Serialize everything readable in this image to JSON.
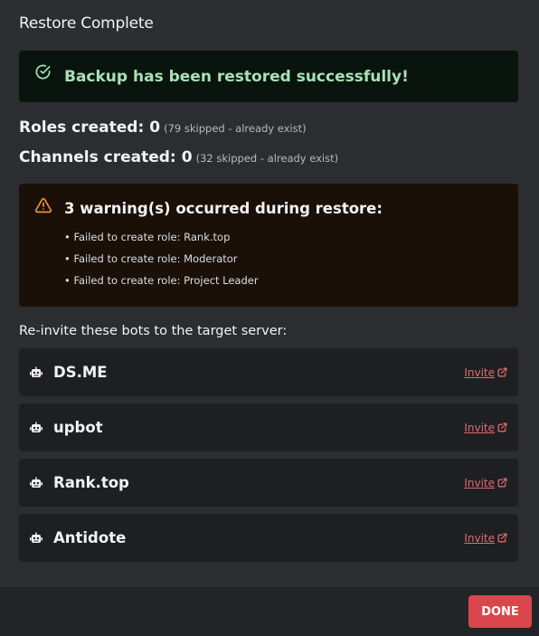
{
  "header": {
    "title": "Restore Complete"
  },
  "success": {
    "icon": "check-circle-icon",
    "message": "Backup has been restored successfully!",
    "color": "#a6e3b4"
  },
  "stats": [
    {
      "label": "Roles created:",
      "value": "0",
      "note": "(79 skipped - already exist)"
    },
    {
      "label": "Channels created:",
      "value": "0",
      "note": "(32 skipped - already exist)"
    }
  ],
  "warnings": {
    "icon": "warning-triangle-icon",
    "title": "3 warning(s) occurred during restore:",
    "items": [
      "• Failed to create role: Rank.top",
      "• Failed to create role: Moderator",
      "• Failed to create role: Project Leader"
    ]
  },
  "reinvite_label": "Re-invite these bots to the target server:",
  "bots": [
    {
      "name": "DS.ME",
      "invite_label": "Invite",
      "icon": "robot-icon"
    },
    {
      "name": "upbot",
      "invite_label": "Invite",
      "icon": "robot-icon"
    },
    {
      "name": "Rank.top",
      "invite_label": "Invite",
      "icon": "robot-icon"
    },
    {
      "name": "Antidote",
      "invite_label": "Invite",
      "icon": "robot-icon"
    }
  ],
  "footer": {
    "done_label": "DONE"
  },
  "colors": {
    "accent": "#d9474c",
    "link": "#e06c6f",
    "warning": "#e8913a",
    "success": "#a6e3b4"
  }
}
